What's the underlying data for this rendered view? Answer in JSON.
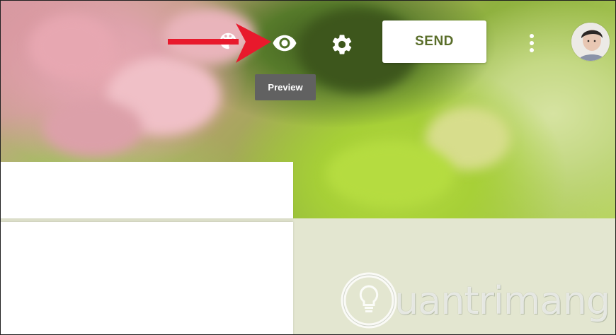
{
  "toolbar": {
    "send_label": "SEND",
    "preview_tooltip": "Preview",
    "icons": {
      "palette": "palette-icon",
      "preview": "eye-icon",
      "settings": "gear-icon",
      "more": "more-vert-icon",
      "avatar": "user-avatar"
    }
  },
  "annotation": {
    "arrow_color": "#e8192c"
  },
  "watermark": {
    "text": "uantrimang",
    "icon": "lightbulb-icon"
  },
  "colors": {
    "send_text": "#5a6e2a",
    "tooltip_bg": "#616161",
    "content_bg": "#e3e6d0"
  }
}
